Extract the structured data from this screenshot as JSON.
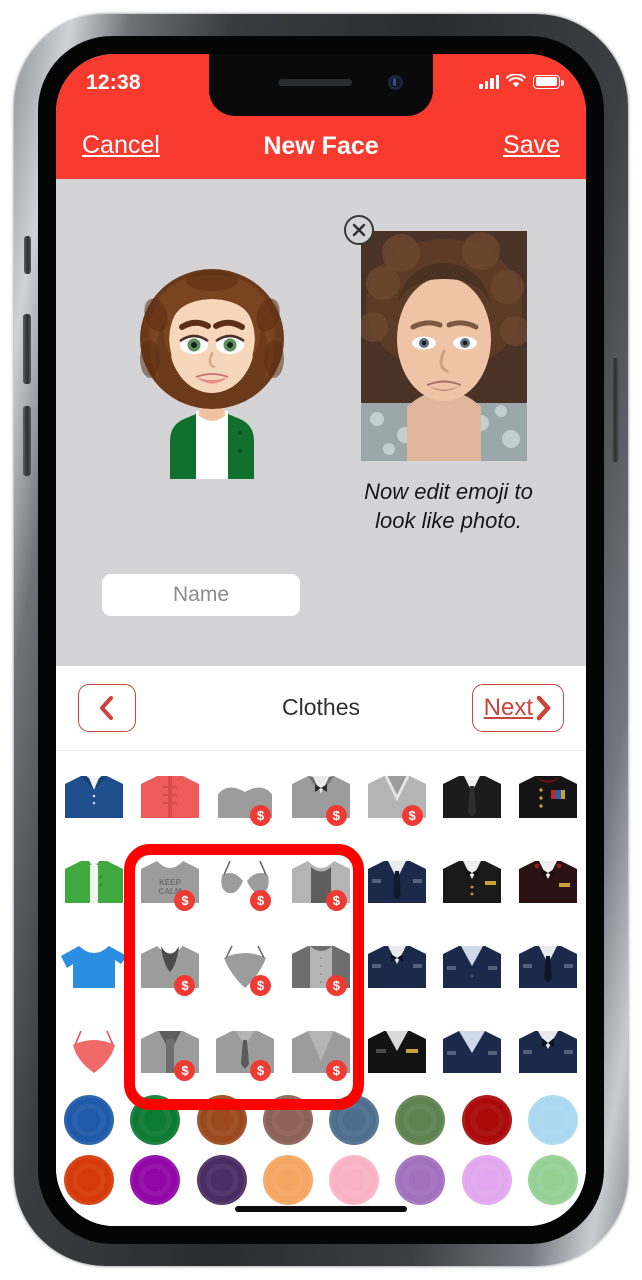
{
  "status_bar": {
    "time": "12:38",
    "signal_icon": "cellular-signal-icon",
    "wifi_icon": "wifi-icon",
    "battery_icon": "battery-icon"
  },
  "nav_bar": {
    "cancel_label": "Cancel",
    "title": "New Face",
    "save_label": "Save",
    "background_color": "#F93A2F"
  },
  "preview": {
    "avatar_alt": "emoji-avatar-preview",
    "photo_alt": "reference-photo-thumbnail",
    "close_icon": "close-circle-icon",
    "instruction": "Now edit emoji to look like photo.",
    "name_placeholder": "Name",
    "name_value": ""
  },
  "picker": {
    "back_icon": "chevron-left-icon",
    "title": "Clothes",
    "next_label": "Next",
    "next_icon": "chevron-right-icon",
    "accent_color": "#C9453C",
    "premium_badge_symbol": "$",
    "rows": [
      [
        {
          "name": "navy-polo-shirt",
          "premium": false
        },
        {
          "name": "red-mandarin-jacket",
          "premium": false
        },
        {
          "name": "strapless-top",
          "premium": true
        },
        {
          "name": "tuxedo-bowtie",
          "premium": true
        },
        {
          "name": "v-neck-sweater",
          "premium": true
        },
        {
          "name": "black-suit-tie",
          "premium": false
        },
        {
          "name": "black-dress-uniform-medals",
          "premium": false
        }
      ],
      [
        {
          "name": "green-cardigan",
          "premium": false
        },
        {
          "name": "keep-calm-tshirt",
          "premium": true
        },
        {
          "name": "bra",
          "premium": true
        },
        {
          "name": "tank-top-layered",
          "premium": true
        },
        {
          "name": "navy-uniform-tie",
          "premium": false
        },
        {
          "name": "black-uniform-bowtie",
          "premium": false
        },
        {
          "name": "dark-red-uniform",
          "premium": false
        }
      ],
      [
        {
          "name": "blue-tshirt",
          "premium": false
        },
        {
          "name": "scarf-top",
          "premium": true
        },
        {
          "name": "camisole",
          "premium": true
        },
        {
          "name": "button-up-blouse",
          "premium": true
        },
        {
          "name": "navy-uniform-bowtie",
          "premium": false
        },
        {
          "name": "navy-uniform-collar",
          "premium": false
        },
        {
          "name": "navy-uniform-necktie",
          "premium": false
        }
      ],
      [
        {
          "name": "coral-bra-top",
          "premium": false
        },
        {
          "name": "gray-cardigan",
          "premium": true
        },
        {
          "name": "shirt-with-tie",
          "premium": true
        },
        {
          "name": "deep-v-sweater",
          "premium": true
        },
        {
          "name": "black-uniform-vneck",
          "premium": false
        },
        {
          "name": "navy-uniform-wide-collar",
          "premium": false
        },
        {
          "name": "navy-uniform-bowtie-2",
          "premium": false
        }
      ]
    ],
    "color_rows": [
      [
        "#1E5AA8",
        "#0E7A33",
        "#9B4A1E",
        "#8D6258",
        "#4E6E8E",
        "#5E8352",
        "#A90A0A",
        "#A9D8F0"
      ],
      [
        "#D53A0A",
        "#9206A8",
        "#4A2D63",
        "#F5A663",
        "#FBB3C4",
        "#A171BE",
        "#E2A7EE",
        "#96D194"
      ]
    ]
  },
  "annotation": {
    "shape": "rounded-rectangle-highlight",
    "color": "#FF0000"
  },
  "home_indicator": "home-indicator-bar"
}
